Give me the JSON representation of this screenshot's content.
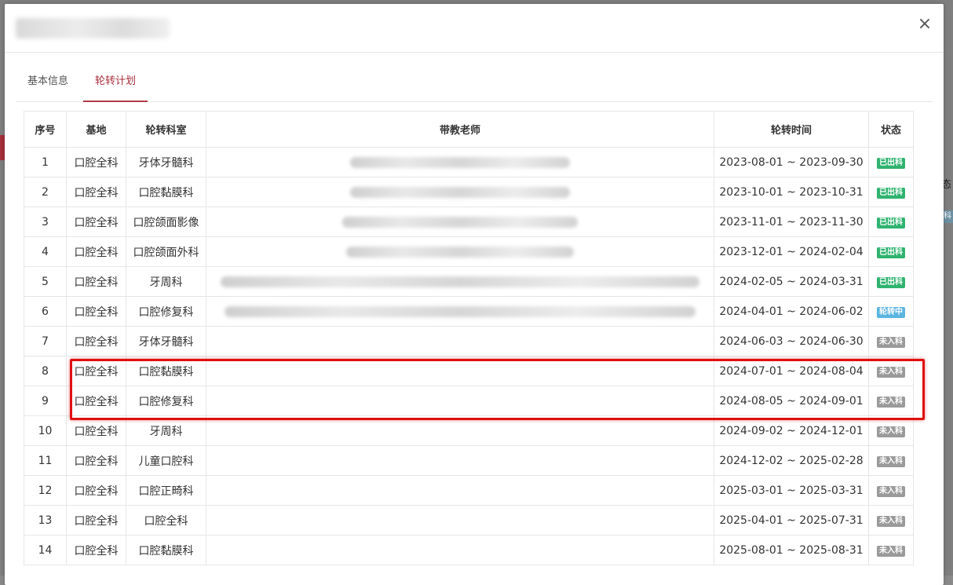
{
  "modal": {
    "close_icon": "×",
    "tabs": [
      {
        "label": "基本信息",
        "active": false
      },
      {
        "label": "轮转计划",
        "active": true
      }
    ]
  },
  "background": {
    "right_text": "态",
    "right_tag": "科"
  },
  "table": {
    "headers": [
      "序号",
      "基地",
      "轮转科室",
      "带教老师",
      "轮转时间",
      "状态"
    ],
    "rows": [
      {
        "no": "1",
        "base": "口腔全科",
        "dept": "牙体牙髓科",
        "teacher_blur": 280,
        "time": "2023-08-01 ~ 2023-09-30",
        "status": "已出科",
        "status_color": "#2fb36f"
      },
      {
        "no": "2",
        "base": "口腔全科",
        "dept": "口腔黏膜科",
        "teacher_blur": 280,
        "time": "2023-10-01 ~ 2023-10-31",
        "status": "已出科",
        "status_color": "#2fb36f"
      },
      {
        "no": "3",
        "base": "口腔全科",
        "dept": "口腔颌面影像",
        "teacher_blur": 300,
        "time": "2023-11-01 ~ 2023-11-30",
        "status": "已出科",
        "status_color": "#2fb36f"
      },
      {
        "no": "4",
        "base": "口腔全科",
        "dept": "口腔颌面外科",
        "teacher_blur": 290,
        "time": "2023-12-01 ~ 2024-02-04",
        "status": "已出科",
        "status_color": "#2fb36f"
      },
      {
        "no": "5",
        "base": "口腔全科",
        "dept": "牙周科",
        "teacher_blur": 610,
        "time": "2024-02-05 ~ 2024-03-31",
        "status": "已出科",
        "status_color": "#2fb36f"
      },
      {
        "no": "6",
        "base": "口腔全科",
        "dept": "口腔修复科",
        "teacher_blur": 600,
        "time": "2024-04-01 ~ 2024-06-02",
        "status": "轮转中",
        "status_color": "#5bb5e0"
      },
      {
        "no": "7",
        "base": "口腔全科",
        "dept": "牙体牙髓科",
        "teacher_blur": 0,
        "time": "2024-06-03 ~ 2024-06-30",
        "status": "未入科",
        "status_color": "#9a9a9a"
      },
      {
        "no": "8",
        "base": "口腔全科",
        "dept": "口腔黏膜科",
        "teacher_blur": 0,
        "time": "2024-07-01 ~ 2024-08-04",
        "status": "未入科",
        "status_color": "#9a9a9a"
      },
      {
        "no": "9",
        "base": "口腔全科",
        "dept": "口腔修复科",
        "teacher_blur": 0,
        "time": "2024-08-05 ~ 2024-09-01",
        "status": "未入科",
        "status_color": "#9a9a9a"
      },
      {
        "no": "10",
        "base": "口腔全科",
        "dept": "牙周科",
        "teacher_blur": 0,
        "time": "2024-09-02 ~ 2024-12-01",
        "status": "未入科",
        "status_color": "#9a9a9a"
      },
      {
        "no": "11",
        "base": "口腔全科",
        "dept": "儿童口腔科",
        "teacher_blur": 0,
        "time": "2024-12-02 ~ 2025-02-28",
        "status": "未入科",
        "status_color": "#9a9a9a"
      },
      {
        "no": "12",
        "base": "口腔全科",
        "dept": "口腔正畸科",
        "teacher_blur": 0,
        "time": "2025-03-01 ~ 2025-03-31",
        "status": "未入科",
        "status_color": "#9a9a9a"
      },
      {
        "no": "13",
        "base": "口腔全科",
        "dept": "口腔全科",
        "teacher_blur": 0,
        "time": "2025-04-01 ~ 2025-07-31",
        "status": "未入科",
        "status_color": "#9a9a9a"
      },
      {
        "no": "14",
        "base": "口腔全科",
        "dept": "口腔黏膜科",
        "teacher_blur": 0,
        "time": "2025-08-01 ~ 2025-08-31",
        "status": "未入科",
        "status_color": "#9a9a9a"
      }
    ]
  }
}
